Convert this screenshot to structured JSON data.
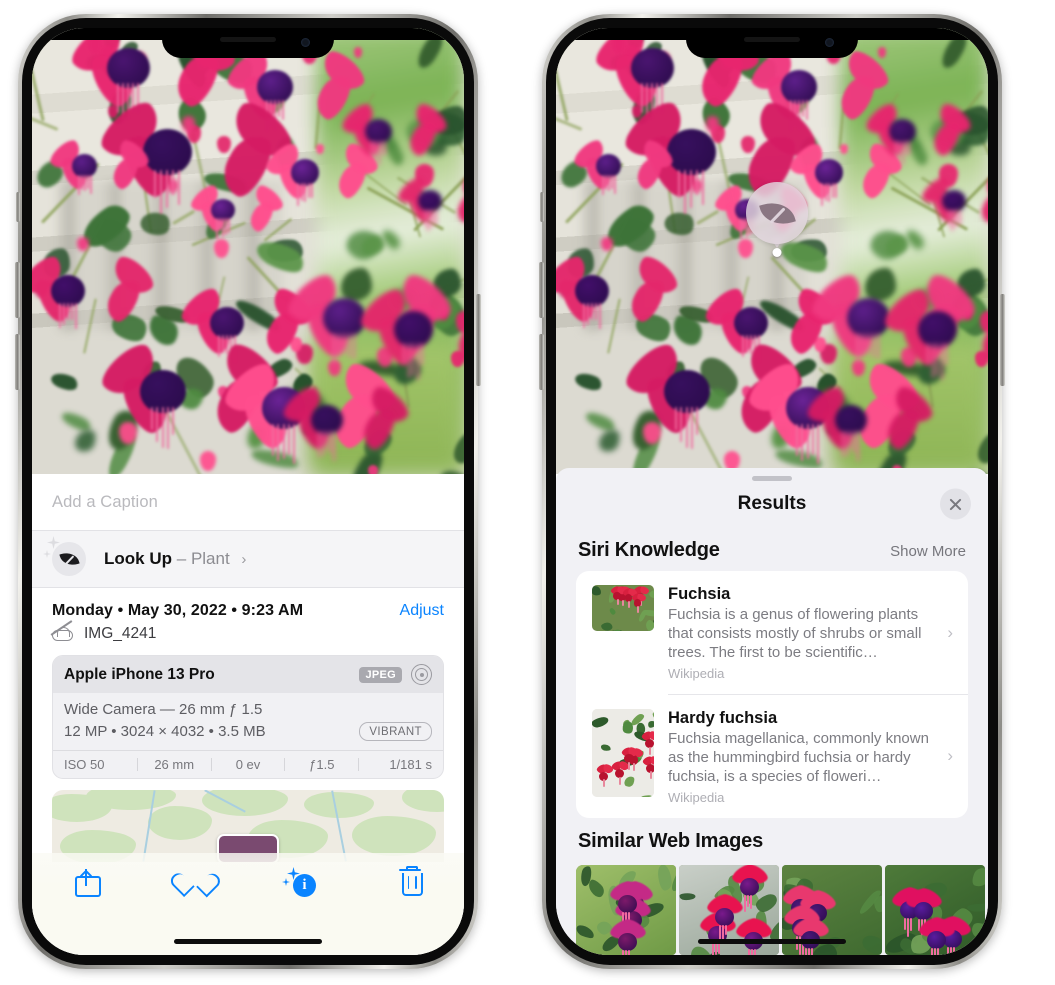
{
  "left_phone": {
    "caption_field": {
      "placeholder": "Add a Caption",
      "value": ""
    },
    "look_up": {
      "label": "Look Up",
      "dash": "–",
      "subject": "Plant",
      "chevron": "›",
      "icon": "leaf-icon"
    },
    "date_row": {
      "date": "Monday • May 30, 2022 • 9:23 AM",
      "adjust_label": "Adjust"
    },
    "file_row": {
      "filename": "IMG_4241",
      "icon": "cloud-slash-icon"
    },
    "exif": {
      "device": "Apple iPhone 13 Pro",
      "format_tag": "JPEG",
      "aperture_icon": "aperture-icon",
      "lens_line": "Wide Camera — 26 mm ƒ 1.5",
      "size_line": "12 MP • 3024 × 4032 • 3.5 MB",
      "style_tag": "VIBRANT",
      "stats": [
        "ISO 50",
        "26 mm",
        "0 ev",
        "ƒ1.5",
        "1/181 s"
      ]
    },
    "toolbar": [
      {
        "name": "share-button",
        "icon": "share-icon"
      },
      {
        "name": "favorite-button",
        "icon": "heart-icon"
      },
      {
        "name": "info-button",
        "icon": "info-sparkle-icon",
        "glyph": "i"
      },
      {
        "name": "delete-button",
        "icon": "trash-icon"
      }
    ]
  },
  "right_phone": {
    "visual_lookup_badge": {
      "icon": "leaf-icon"
    },
    "sheet": {
      "title": "Results",
      "close_label": "close-icon",
      "sections": [
        {
          "title": "Siri Knowledge",
          "action": "Show More",
          "items": [
            {
              "title": "Fuchsia",
              "description": "Fuchsia is a genus of flowering plants that consists mostly of shrubs or small trees. The first to be scientific…",
              "source": "Wikipedia",
              "chevron": "›"
            },
            {
              "title": "Hardy fuchsia",
              "description": "Fuchsia magellanica, commonly known as the hummingbird fuchsia or hardy fuchsia, is a species of floweri…",
              "source": "Wikipedia",
              "chevron": "›"
            }
          ]
        },
        {
          "title": "Similar Web Images",
          "action": "",
          "thumbnails": 4
        }
      ]
    }
  },
  "colors": {
    "accent_blue": "#0a84ff",
    "sheet_bg": "#f1f1f5",
    "card_bg": "#ffffff",
    "secondary_text": "#7c7c82",
    "tertiary_text": "#aeaeb4"
  }
}
